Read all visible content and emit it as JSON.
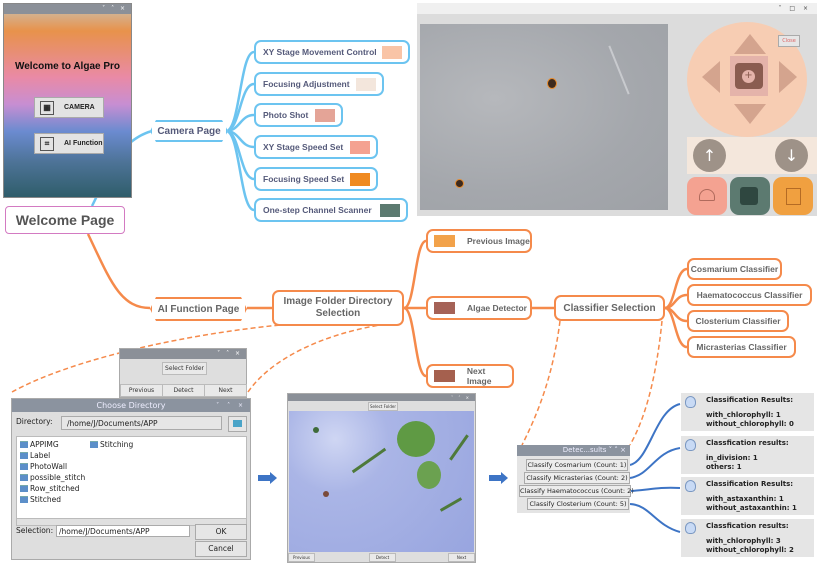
{
  "welcome_window": {
    "title": "Welcome to Algae Pro",
    "window_controls": "˅ ˄ ×",
    "buttons": [
      {
        "label": "CAMERA",
        "icon": "camera-scene-icon"
      },
      {
        "label": "AI Function",
        "icon": "ai-scan-icon"
      }
    ]
  },
  "nodes": {
    "welcome_page": "Welcome Page",
    "camera_page": "Camera Page",
    "ai_function_page": "AI Function Page",
    "image_folder": "Image Folder Directory Selection",
    "classifier_selection": "Classifier Selection"
  },
  "camera_features": [
    {
      "label": "XY Stage Movement Control",
      "color": "#f9c4a6"
    },
    {
      "label": "Focusing Adjustment",
      "color": "#f3e6dc"
    },
    {
      "label": "Photo Shot",
      "color": "#e4a497"
    },
    {
      "label": "XY Stage Speed Set",
      "color": "#f4a291"
    },
    {
      "label": "Focusing Speed Set",
      "color": "#f08a20"
    },
    {
      "label": "One-step Channel Scanner",
      "color": "#5c7a70"
    }
  ],
  "ai_features": [
    {
      "label": "Previous Image",
      "color": "#f2a24a"
    },
    {
      "label": "Algae Detector",
      "color": "#a56257"
    },
    {
      "label": "Next Image",
      "color": "#a5604e"
    }
  ],
  "classifiers": [
    "Cosmarium Classifier",
    "Haematococcus Classifier",
    "Closterium Classifier",
    "Micrasterias Classifier"
  ],
  "camera_window": {
    "close_label": "Close",
    "window_controls": "˅ □ ×",
    "colors": {
      "circle": "#f7cdb3",
      "speed_row": "#f4e7dc",
      "speed_tile": "#f4a291",
      "scanner_tile": "#5c7a70",
      "focus_tile": "#f0a040"
    }
  },
  "small_window": {
    "select_folder": "Select Folder",
    "previous": "Previous",
    "detect": "Detect",
    "next": "Next"
  },
  "choose_directory": {
    "title": "Choose Directory",
    "directory_label": "Directory:",
    "directory_value": "/home/J/Documents/APP",
    "folders_col1": [
      "APPIMG",
      "Label",
      "PhotoWall",
      "possible_stitch",
      "Row_stitched",
      "Stitched"
    ],
    "folders_col2": [
      "Stitching"
    ],
    "selection_label": "Selection:",
    "selection_value": "/home/J/Documents/APP",
    "ok_label": "OK",
    "cancel_label": "Cancel"
  },
  "detector_window": {
    "select_folder": "Select Folder",
    "previous": "Previous",
    "detect": "Detect",
    "next": "Next"
  },
  "results_window": {
    "title": "Detec...sults",
    "buttons": [
      "Classify Cosmarium (Count: 1)",
      "Classify Micrasterias (Count: 2)",
      "Classify Haematococcus (Count: 2)",
      "Classify Closterium (Count: 5)"
    ]
  },
  "classification_results": [
    {
      "header": "Classification Results:",
      "line1": "with_chlorophyll: 1",
      "line2": "without_chlorophyll: 0"
    },
    {
      "header": "Classfication results:",
      "line1": "in_division: 1",
      "line2": "others: 1"
    },
    {
      "header": "Classification Results:",
      "line1": "with_astaxanthin: 1",
      "line2": "without_astaxanthin: 1"
    },
    {
      "header": "Classfication results:",
      "line1": "with_chlorophyll: 3",
      "line2": "without_chlorophyll: 2"
    }
  ],
  "colors": {
    "camera_branch": "#6cc4f0",
    "ai_branch": "#f58a4b",
    "welcome_border": "#d37ac2",
    "result_arrow": "#3d74c5"
  }
}
